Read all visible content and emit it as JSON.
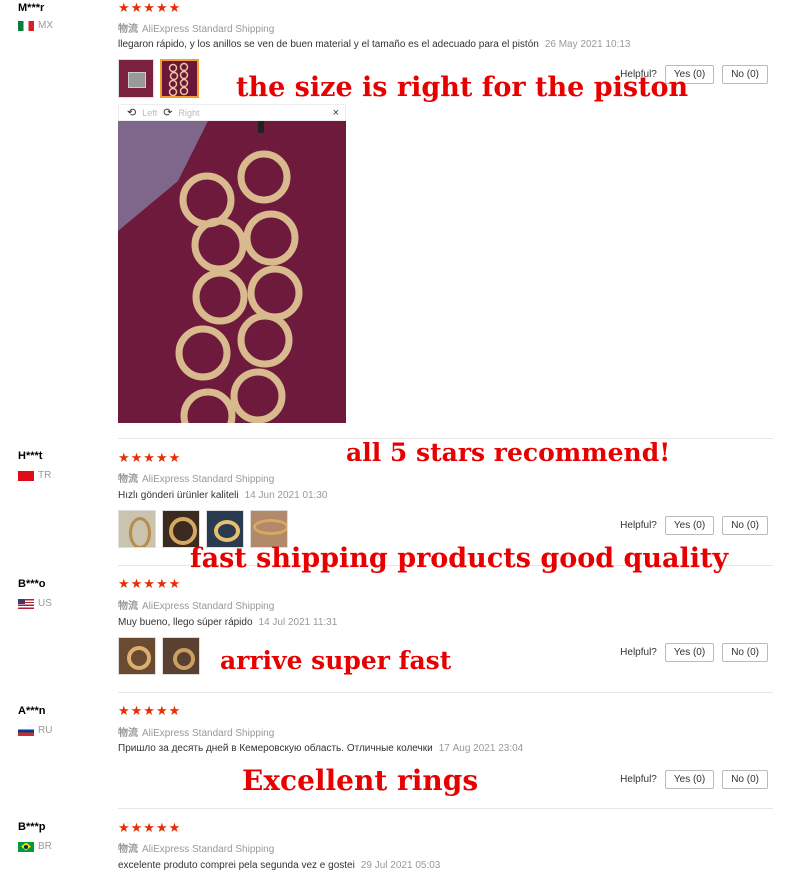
{
  "reviews": [
    {
      "user": "M***r",
      "country": "MX",
      "stars": "★★★★★",
      "ship_label": "物流",
      "shipping": "AliExpress Standard Shipping",
      "text": "llegaron rápido, y los anillos se ven de buen material y el tamaño es el adecuado para el pistón",
      "date": "26 May 2021 10:13",
      "helpful": "Helpful?",
      "yes": "Yes (0)",
      "no": "No (0)"
    },
    {
      "user": "H***t",
      "country": "TR",
      "stars": "★★★★★",
      "ship_label": "物流",
      "shipping": "AliExpress Standard Shipping",
      "text": "Hızlı gönderi ürünler kaliteli",
      "date": "14 Jun 2021 01:30",
      "helpful": "Helpful?",
      "yes": "Yes (0)",
      "no": "No (0)"
    },
    {
      "user": "B***o",
      "country": "US",
      "stars": "★★★★★",
      "ship_label": "物流",
      "shipping": "AliExpress Standard Shipping",
      "text": "Muy bueno, llego súper rápido",
      "date": "14 Jul 2021 11:31",
      "helpful": "Helpful?",
      "yes": "Yes (0)",
      "no": "No (0)"
    },
    {
      "user": "A***n",
      "country": "RU",
      "stars": "★★★★★",
      "ship_label": "物流",
      "shipping": "AliExpress Standard Shipping",
      "text": "Пришло за десять дней в Кемеровскую область. Отличные колечки",
      "date": "17 Aug 2021 23:04",
      "helpful": "Helpful?",
      "yes": "Yes (0)",
      "no": "No (0)"
    },
    {
      "user": "B***p",
      "country": "BR",
      "stars": "★★★★★",
      "ship_label": "物流",
      "shipping": "AliExpress Standard Shipping",
      "text": "excelente produto comprei pela segunda vez e gostei",
      "date": "29 Jul 2021 05:03"
    }
  ],
  "viewer": {
    "left": "Left",
    "right": "Right",
    "close": "×"
  },
  "annotations": {
    "a1": "the size is right for the piston",
    "a2": "all 5 stars recommend!",
    "a3": "fast shipping products good quality",
    "a4": "arrive super fast",
    "a5": "Excellent rings"
  },
  "colors": {
    "star": "#e62e04",
    "annotation": "#e80000",
    "thumb_selected": "#f0a030"
  }
}
